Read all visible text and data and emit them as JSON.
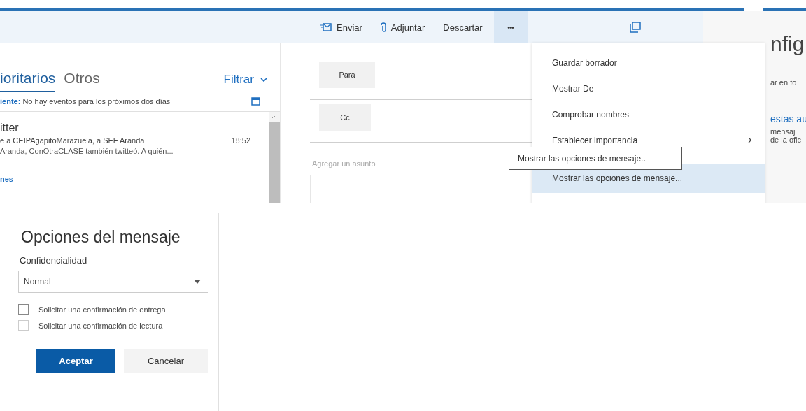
{
  "toolbar": {
    "buttons": [
      {
        "kind": "send",
        "label": "Enviar",
        "selected": false
      },
      {
        "kind": "attach",
        "label": "Adjuntar",
        "selected": false
      },
      {
        "kind": "text",
        "label": "Descartar",
        "selected": false
      },
      {
        "kind": "text",
        "label": "•••",
        "selected": true
      },
      {
        "kind": "popout",
        "selected": false
      }
    ]
  },
  "mail_list": {
    "tabs": [
      {
        "label": "ioritarios",
        "selected": true
      },
      {
        "label": "Otros",
        "selected": false
      }
    ],
    "filter": "Filtrar",
    "agenda": "**iente:** No hay eventos para los próximos dos días",
    "messages": [
      {
        "sender": "itter",
        "subject": "e a CEIPAgapitoMarazuela, a SEF Aranda",
        "time": "18:52",
        "preview": "Aranda, ConOtraCLASE también twitteó. A quién..."
      }
    ],
    "link": "nes"
  },
  "compose": {
    "to": "Para",
    "cc": "Cc",
    "subject": {
      "placeholder": "Agregar un asunto"
    }
  },
  "menu": {
    "items": [
      {
        "label": "Guardar borrador",
        "submenu": false,
        "selected": false
      },
      {
        "label": "Mostrar De",
        "submenu": false,
        "selected": false
      },
      {
        "label": "Comprobar nombres",
        "submenu": false,
        "selected": false
      },
      {
        "label": "Establecer importancia",
        "submenu": true,
        "selected": false
      },
      {
        "label": "Mostrar las opciones de mensaje...",
        "submenu": false,
        "selected": true
      }
    ]
  },
  "tooltip": "Mostrar las opciones de mensaje..",
  "settings_panel": {
    "title": "nfig",
    "lines": [
      {
        "kind": "text",
        "text": "ar en to"
      },
      {
        "kind": "heading",
        "text": "estas au"
      },
      {
        "kind": "text",
        "text": "mensaj"
      },
      {
        "kind": "text",
        "text": "de la ofic"
      }
    ]
  },
  "dialog": {
    "title": "Opciones del mensaje",
    "sensitivity": {
      "label": "Confidencialidad",
      "value": "Normal"
    },
    "options": [
      {
        "label": "Solicitar una confirmación de entrega",
        "checked": false
      },
      {
        "label": "Solicitar una confirmación de lectura",
        "checked": false
      }
    ],
    "buttons": [
      {
        "label": "Aceptar",
        "kind": "primary"
      },
      {
        "label": "Cancelar",
        "kind": "secondary"
      }
    ]
  }
}
